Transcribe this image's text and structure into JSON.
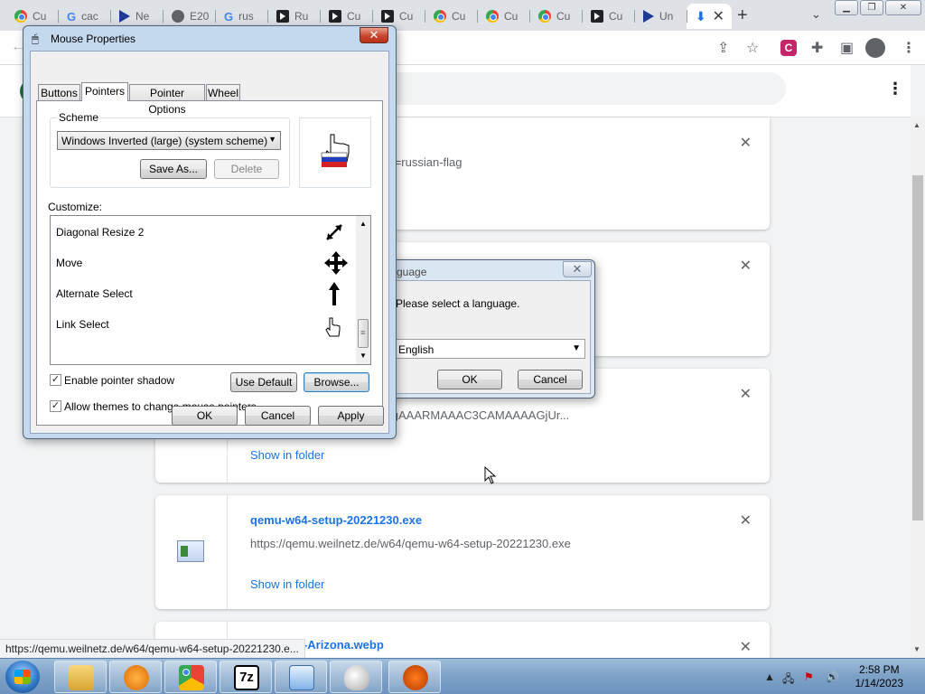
{
  "browser": {
    "tabs": [
      {
        "label": "Cu",
        "favicon": "chrome-icon"
      },
      {
        "label": "cac",
        "favicon": "google-icon"
      },
      {
        "label": "Ne",
        "favicon": "cursor-icon"
      },
      {
        "label": "E20",
        "favicon": "globe-icon"
      },
      {
        "label": "rus",
        "favicon": "google-icon"
      },
      {
        "label": "Ru",
        "favicon": "black-app-icon"
      },
      {
        "label": "Cu",
        "favicon": "black-app-icon"
      },
      {
        "label": "Cu",
        "favicon": "black-app-icon"
      },
      {
        "label": "Cu",
        "favicon": "chrome-icon"
      },
      {
        "label": "Cu",
        "favicon": "chrome-icon"
      },
      {
        "label": "Cu",
        "favicon": "chrome-icon"
      },
      {
        "label": "Cu",
        "favicon": "black-app-icon"
      },
      {
        "label": "Un",
        "favicon": "cursor-icon"
      },
      {
        "label": "",
        "favicon": "download-icon",
        "active": true
      }
    ],
    "new_tab": "+",
    "tab_close": "✕"
  },
  "downloads": {
    "items": [
      {
        "name": "",
        "url": "/cursor-downloadset.php?id=russian-flag",
        "link": ""
      },
      {
        "name": "",
        "url": "",
        "link": ""
      },
      {
        "name": "",
        "url": "ORw0KGgoAAAANSUhEUgAAARMAAAC3CAMAAAAGjUr...",
        "link": "Show in folder"
      },
      {
        "name": "qemu-w64-setup-20221230.exe",
        "url": "https://qemu.weilnetz.de/w64/qemu-w64-setup-20221230.exe",
        "link": "Show in folder"
      },
      {
        "name": "actus-Arizona.webp",
        "url": "",
        "link": ""
      }
    ],
    "status_url": "https://qemu.weilnetz.de/w64/qemu-w64-setup-20221230.e..."
  },
  "mouse_dialog": {
    "title": "Mouse Properties",
    "tabs": [
      "Buttons",
      "Pointers",
      "Pointer Options",
      "Wheel"
    ],
    "active_tab": "Pointers",
    "scheme_label": "Scheme",
    "scheme_value": "Windows Inverted (large) (system scheme)",
    "save_as": "Save As...",
    "delete": "Delete",
    "customize_label": "Customize:",
    "pointers": [
      {
        "name": "Diagonal Resize 2",
        "icon": "diagonal-resize-icon"
      },
      {
        "name": "Move",
        "icon": "move-icon"
      },
      {
        "name": "Alternate Select",
        "icon": "up-arrow-icon"
      },
      {
        "name": "Link Select",
        "icon": "hand-pointer-icon"
      }
    ],
    "enable_shadow": "Enable pointer shadow",
    "allow_themes": "Allow themes to change mouse pointers",
    "use_default": "Use Default",
    "browse": "Browse...",
    "ok": "OK",
    "cancel": "Cancel",
    "apply": "Apply"
  },
  "language_dialog": {
    "title": "guage",
    "prompt": "Please select a language.",
    "selected": "English",
    "ok": "OK",
    "cancel": "Cancel"
  },
  "taskbar": {
    "time": "2:58 PM",
    "date": "1/14/2023",
    "apps": [
      "file-explorer-icon",
      "media-player-icon",
      "chrome-icon",
      "7zip-icon",
      "control-panel-icon",
      "mouse-icon",
      "qemu-icon"
    ],
    "sevenzip_label": "7z"
  }
}
